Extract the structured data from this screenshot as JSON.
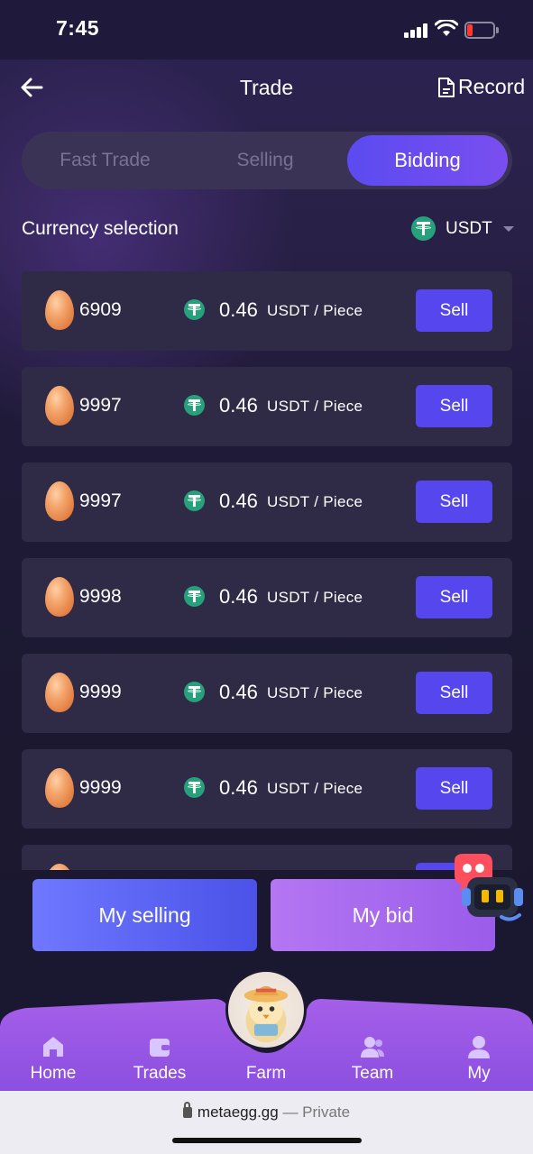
{
  "status_bar": {
    "time": "7:45",
    "battery_color": "#ff3b30"
  },
  "header": {
    "title": "Trade",
    "record_label": "Record"
  },
  "tabs": [
    {
      "label": "Fast Trade",
      "active": false
    },
    {
      "label": "Selling",
      "active": false
    },
    {
      "label": "Bidding",
      "active": true
    }
  ],
  "currency": {
    "label": "Currency selection",
    "value": "USDT"
  },
  "listings": [
    {
      "qty": "6909",
      "price": "0.46",
      "unit": "USDT / Piece",
      "action": "Sell"
    },
    {
      "qty": "9997",
      "price": "0.46",
      "unit": "USDT / Piece",
      "action": "Sell"
    },
    {
      "qty": "9997",
      "price": "0.46",
      "unit": "USDT / Piece",
      "action": "Sell"
    },
    {
      "qty": "9998",
      "price": "0.46",
      "unit": "USDT / Piece",
      "action": "Sell"
    },
    {
      "qty": "9999",
      "price": "0.46",
      "unit": "USDT / Piece",
      "action": "Sell"
    },
    {
      "qty": "9999",
      "price": "0.46",
      "unit": "USDT / Piece",
      "action": "Sell"
    },
    {
      "qty": "",
      "price": "",
      "unit": "",
      "action": ""
    }
  ],
  "actions": {
    "my_selling": "My selling",
    "my_bid": "My bid"
  },
  "tab_bar": {
    "items": [
      {
        "label": "Home",
        "icon": "home-icon"
      },
      {
        "label": "Trades",
        "icon": "wallet-icon"
      },
      {
        "label": "Farm",
        "icon": "chick-avatar-icon"
      },
      {
        "label": "Team",
        "icon": "team-icon"
      },
      {
        "label": "My",
        "icon": "user-icon"
      }
    ]
  },
  "browser": {
    "domain": "metaegg.gg",
    "privacy": "— Private"
  },
  "colors": {
    "accent": "#5546ee",
    "tab_active": "#7a4ef0",
    "tether": "#26a17b",
    "tab_bar": "#9b5ae6"
  }
}
